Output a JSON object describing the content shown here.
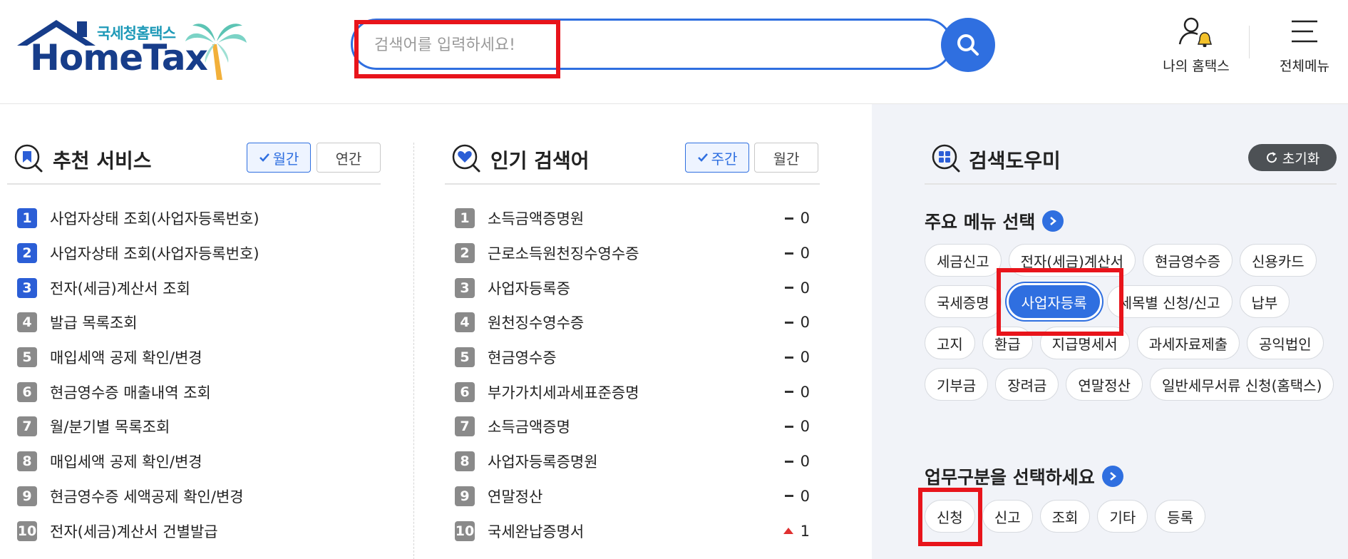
{
  "header": {
    "logo_kor": "국세청홈택스",
    "logo_eng": "HomeTax",
    "search_placeholder": "검색어를 입력하세요!",
    "my_hometax_label": "나의 홈택스",
    "all_menu_label": "전체메뉴"
  },
  "recommend": {
    "title": "추천 서비스",
    "toggle_active": "월간",
    "toggle_inactive": "연간",
    "items": [
      {
        "rank": "1",
        "label": "사업자상태 조회(사업자등록번호)"
      },
      {
        "rank": "2",
        "label": "사업자상태 조회(사업자등록번호)"
      },
      {
        "rank": "3",
        "label": "전자(세금)계산서 조회"
      },
      {
        "rank": "4",
        "label": "발급 목록조회"
      },
      {
        "rank": "5",
        "label": "매입세액 공제 확인/변경"
      },
      {
        "rank": "6",
        "label": "현금영수증 매출내역 조회"
      },
      {
        "rank": "7",
        "label": "월/분기별 목록조회"
      },
      {
        "rank": "8",
        "label": "매입세액 공제 확인/변경"
      },
      {
        "rank": "9",
        "label": "현금영수증 세액공제 확인/변경"
      },
      {
        "rank": "10",
        "label": "전자(세금)계산서 건별발급"
      }
    ]
  },
  "popular": {
    "title": "인기 검색어",
    "toggle_active": "주간",
    "toggle_inactive": "월간",
    "items": [
      {
        "rank": "1",
        "label": "소득금액증명원",
        "change": "0",
        "trend": "same"
      },
      {
        "rank": "2",
        "label": "근로소득원천징수영수증",
        "change": "0",
        "trend": "same"
      },
      {
        "rank": "3",
        "label": "사업자등록증",
        "change": "0",
        "trend": "same"
      },
      {
        "rank": "4",
        "label": "원천징수영수증",
        "change": "0",
        "trend": "same"
      },
      {
        "rank": "5",
        "label": "현금영수증",
        "change": "0",
        "trend": "same"
      },
      {
        "rank": "6",
        "label": "부가가치세과세표준증명",
        "change": "0",
        "trend": "same"
      },
      {
        "rank": "7",
        "label": "소득금액증명",
        "change": "0",
        "trend": "same"
      },
      {
        "rank": "8",
        "label": "사업자등록증명원",
        "change": "0",
        "trend": "same"
      },
      {
        "rank": "9",
        "label": "연말정산",
        "change": "0",
        "trend": "same"
      },
      {
        "rank": "10",
        "label": "국세완납증명서",
        "change": "1",
        "trend": "up"
      }
    ]
  },
  "helper": {
    "title": "검색도우미",
    "reset_label": "초기화",
    "menu_title": "주요 메뉴 선택",
    "menu_chips": [
      "세금신고",
      "전자(세금)계산서",
      "현금영수증",
      "신용카드",
      "국세증명",
      "사업자등록",
      "세목별 신청/신고",
      "납부",
      "고지",
      "환급",
      "지급명세서",
      "과세자료제출",
      "공익법인",
      "기부금",
      "장려금",
      "연말정산",
      "일반세무서류 신청(홈택스)"
    ],
    "menu_selected": "사업자등록",
    "task_title": "업무구분을 선택하세요",
    "task_chips": [
      "신청",
      "신고",
      "조회",
      "기타",
      "등록"
    ]
  },
  "colors": {
    "accent": "#2f6fe0",
    "highlight": "#e8141b",
    "rank_top": "#2b5ed6",
    "rank_rest": "#8a8a8a",
    "trend_up": "#e03030"
  }
}
